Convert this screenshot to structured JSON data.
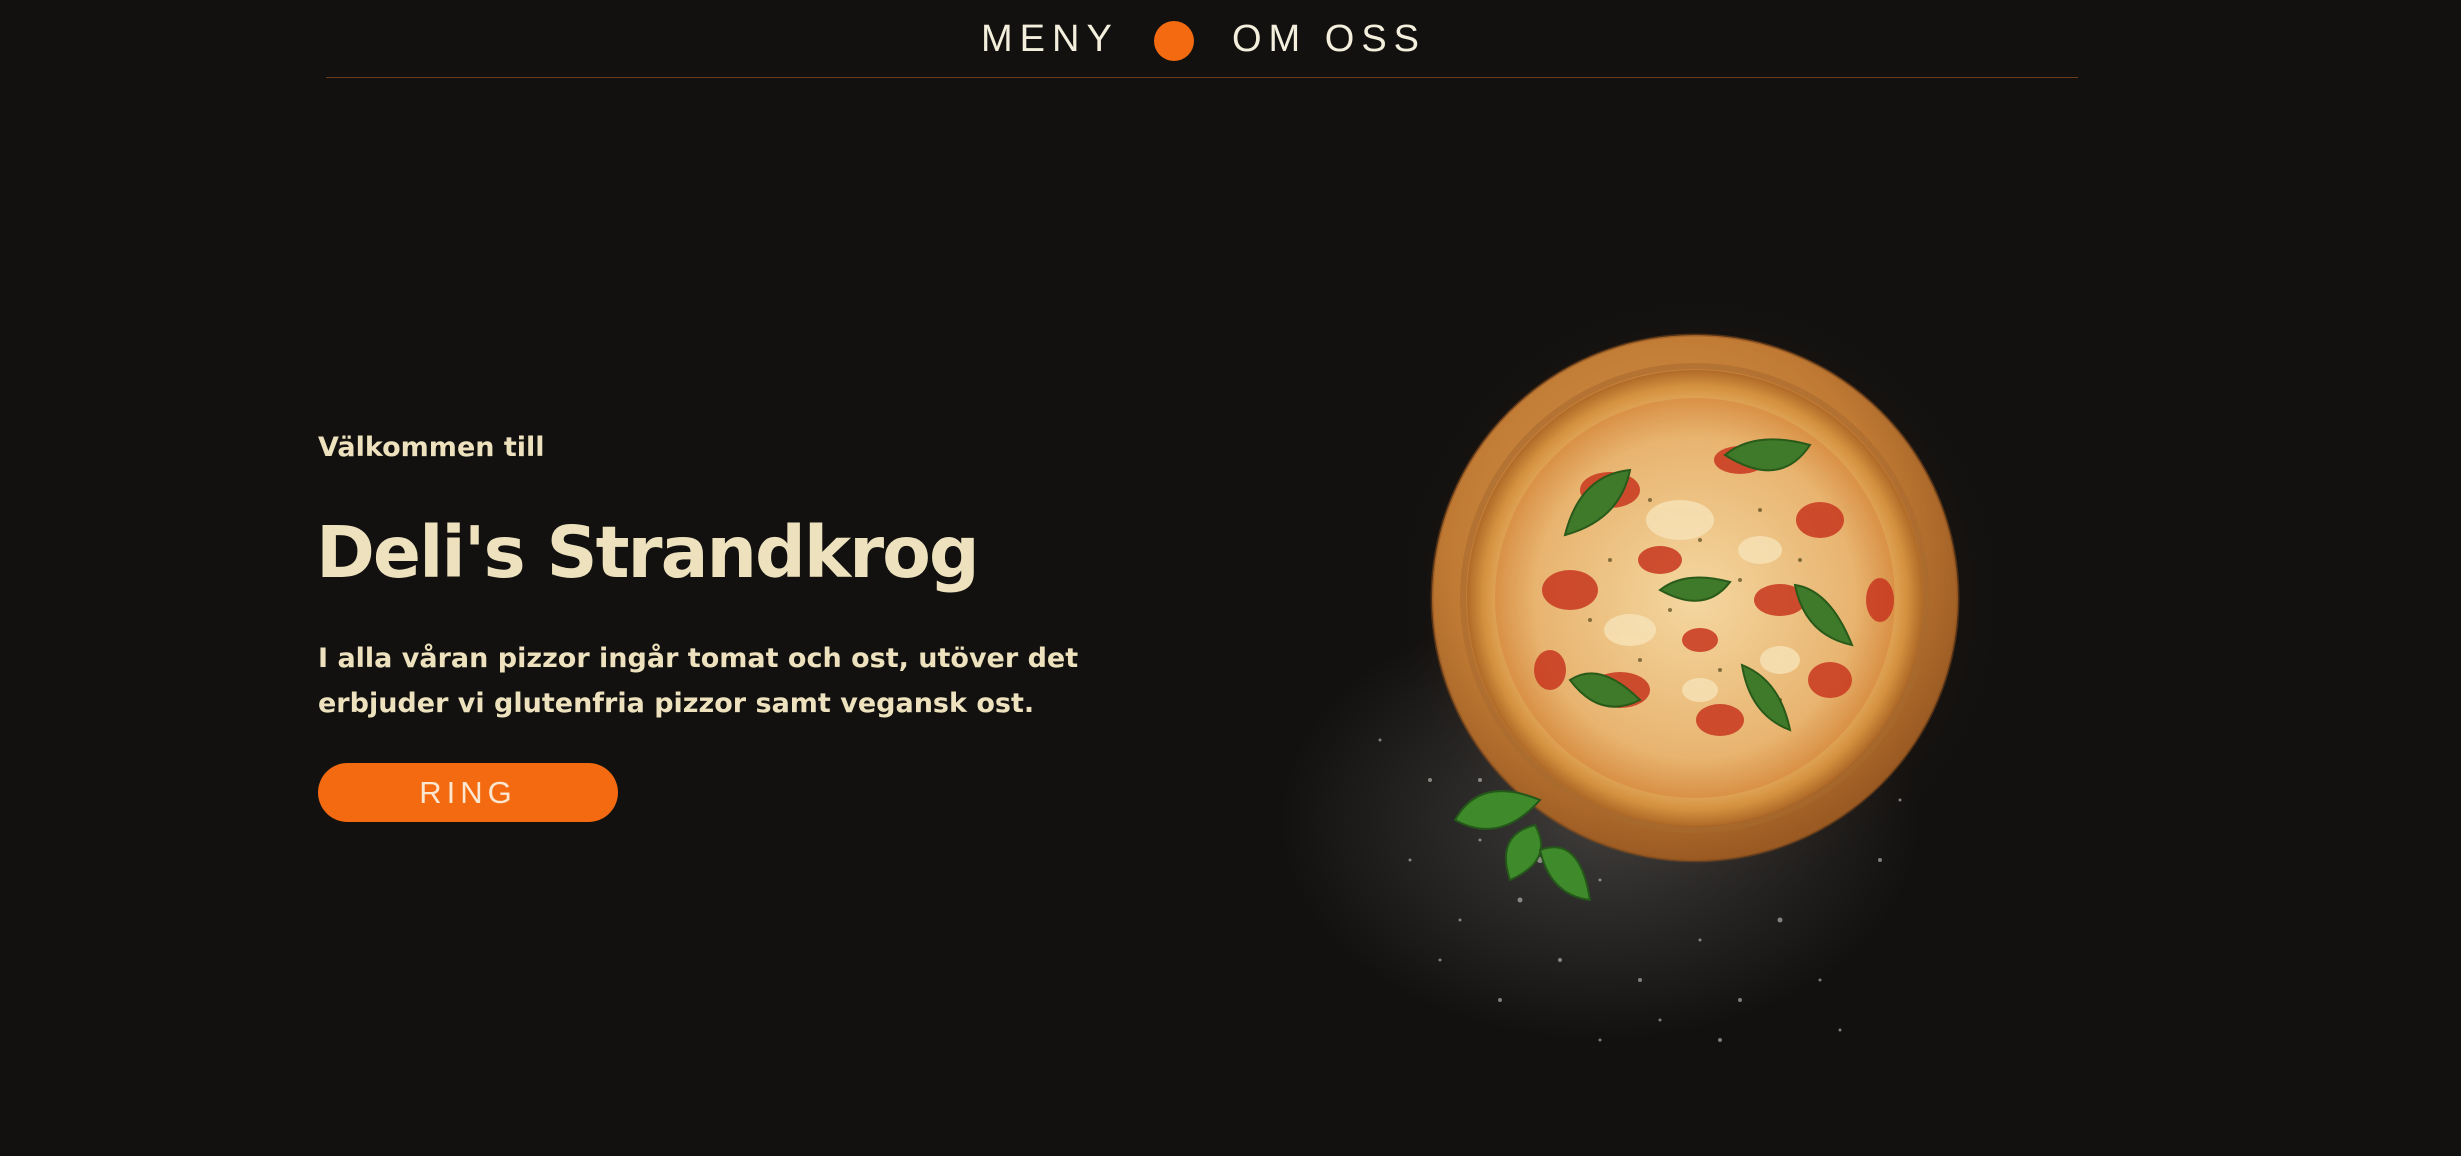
{
  "nav": {
    "left_label": "MENY",
    "right_label": "OM OSS"
  },
  "hero": {
    "eyebrow": "Välkommen till",
    "title": "Deli's Strandkrog",
    "description": "I alla våran pizzor ingår tomat och ost, utöver det erbjuder vi glutenfria pizzor samt vegansk ost.",
    "cta_label": "RING"
  },
  "image": {
    "subject": "pizza-icon"
  },
  "colors": {
    "background": "#121110",
    "accent": "#f36a10",
    "text_light": "#ede2bd",
    "nav_text": "#f3efdc",
    "divider": "#6a3d1c"
  }
}
